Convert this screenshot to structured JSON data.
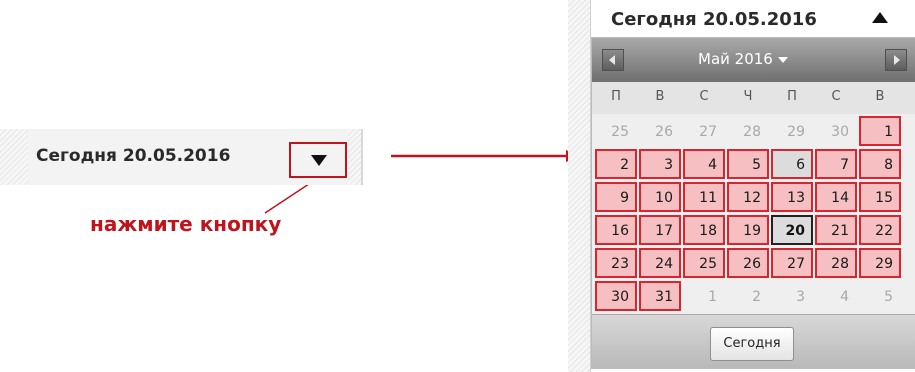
{
  "left_widget": {
    "today_label": "Сегодня 20.05.2016",
    "hint": "нажмите кнопку"
  },
  "calendar": {
    "header_label": "Сегодня 20.05.2016",
    "month_title": "Май 2016",
    "weekdays": [
      "П",
      "В",
      "С",
      "Ч",
      "П",
      "С",
      "В"
    ],
    "weeks": [
      [
        "25",
        "26",
        "27",
        "28",
        "29",
        "30",
        "1"
      ],
      [
        "2",
        "3",
        "4",
        "5",
        "6",
        "7",
        "8"
      ],
      [
        "9",
        "10",
        "11",
        "12",
        "13",
        "14",
        "15"
      ],
      [
        "16",
        "17",
        "18",
        "19",
        "20",
        "21",
        "22"
      ],
      [
        "23",
        "24",
        "25",
        "26",
        "27",
        "28",
        "29"
      ],
      [
        "30",
        "31",
        "1",
        "2",
        "3",
        "4",
        "5"
      ]
    ],
    "today_button": "Сегодня"
  },
  "colors": {
    "accent_red": "#c0141c",
    "day_fill": "#f6bfc1",
    "day_border": "#d7262f"
  },
  "icons": {
    "dropdown": "triangle-down-icon",
    "collapse": "triangle-up-icon",
    "prev": "chevron-left-icon",
    "next": "chevron-right-icon"
  }
}
